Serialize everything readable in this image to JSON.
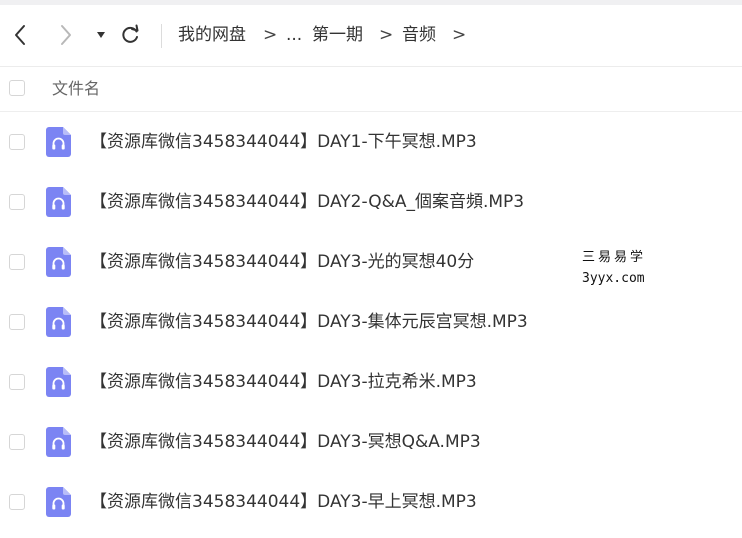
{
  "breadcrumb": {
    "root": "我的网盘",
    "ellipsis": "...",
    "folder1": "第一期",
    "folder2": "音频",
    "separator": ">"
  },
  "list": {
    "column_header": "文件名",
    "files": [
      {
        "name": "【资源库微信3458344044】DAY1-下午冥想.MP3",
        "icon": "audio-file-icon"
      },
      {
        "name": "【资源库微信3458344044】DAY2-Q&A_個案音頻.MP3",
        "icon": "audio-file-icon"
      },
      {
        "name": "【资源库微信3458344044】DAY3-光的冥想40分",
        "icon": "audio-file-icon"
      },
      {
        "name": "【资源库微信3458344044】DAY3-集体元辰宫冥想.MP3",
        "icon": "audio-file-icon"
      },
      {
        "name": "【资源库微信3458344044】DAY3-拉克希米.MP3",
        "icon": "audio-file-icon"
      },
      {
        "name": "【资源库微信3458344044】DAY3-冥想Q&A.MP3",
        "icon": "audio-file-icon"
      },
      {
        "name": "【资源库微信3458344044】DAY3-早上冥想.MP3",
        "icon": "audio-file-icon"
      }
    ]
  },
  "watermark": {
    "line1": "三易易学",
    "line2": "3yyx.com"
  },
  "colors": {
    "icon_accent": "#7b84f3",
    "text": "#333333",
    "muted_text": "#666666"
  }
}
